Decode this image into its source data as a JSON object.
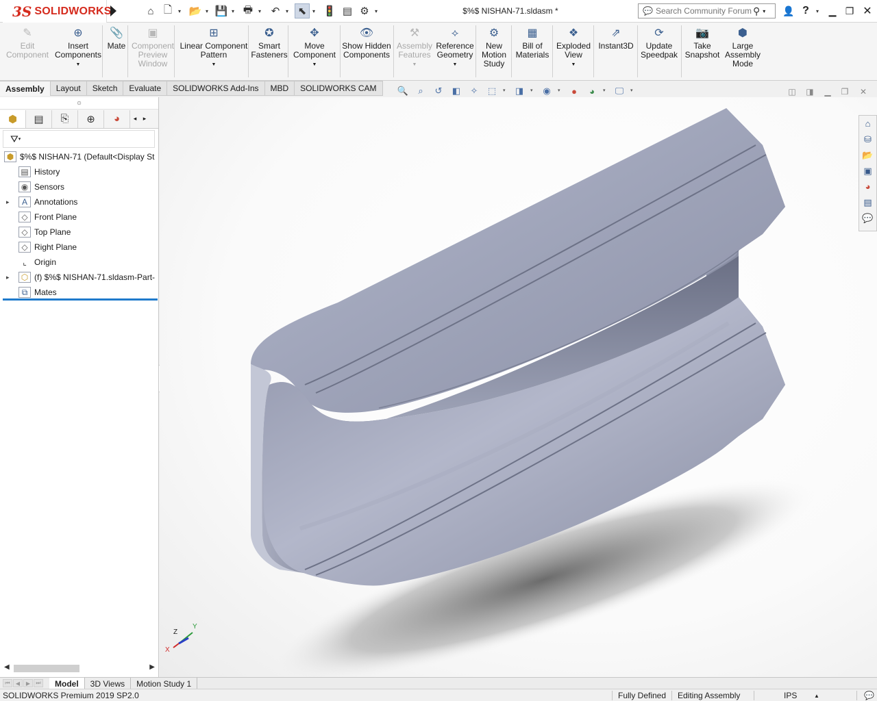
{
  "app": {
    "logo_ds": "3S",
    "logo_text": "SOLIDWORKS",
    "title": "$%$   NISHAN-71.sldasm *"
  },
  "search": {
    "placeholder": "Search Community Forum"
  },
  "quick_access": [
    {
      "name": "home-icon",
      "glyph": "⌂"
    },
    {
      "name": "new-document-icon",
      "glyph": "🗋"
    },
    {
      "name": "open-folder-icon",
      "glyph": "📂"
    },
    {
      "name": "save-icon",
      "glyph": "💾"
    },
    {
      "name": "print-icon",
      "glyph": "🖶"
    },
    {
      "name": "undo-icon",
      "glyph": "↶"
    },
    {
      "name": "select-arrow-icon",
      "glyph": "⬉"
    },
    {
      "name": "rebuild-traffic-light-icon",
      "glyph": "🚦"
    },
    {
      "name": "file-properties-icon",
      "glyph": "▤"
    },
    {
      "name": "options-gear-icon",
      "glyph": "⚙"
    }
  ],
  "command_manager": [
    {
      "key": "edit-component",
      "label": "Edit Component",
      "disabled": true,
      "glyph": "✎",
      "dropdown": false
    },
    {
      "key": "insert-components",
      "label": "Insert Components",
      "disabled": false,
      "glyph": "⊕",
      "dropdown": true
    },
    {
      "key": "mate",
      "label": "Mate",
      "disabled": false,
      "glyph": "📎",
      "dropdown": false
    },
    {
      "key": "component-preview-window",
      "label": "Component Preview Window",
      "disabled": true,
      "glyph": "▣",
      "dropdown": false
    },
    {
      "key": "linear-component-pattern",
      "label": "Linear Component Pattern",
      "disabled": false,
      "glyph": "⊞",
      "dropdown": true
    },
    {
      "key": "smart-fasteners",
      "label": "Smart Fasteners",
      "disabled": false,
      "glyph": "✪",
      "dropdown": false
    },
    {
      "key": "move-component",
      "label": "Move Component",
      "disabled": false,
      "glyph": "✥",
      "dropdown": true
    },
    {
      "key": "show-hidden-components",
      "label": "Show Hidden Components",
      "disabled": false,
      "glyph": "👁",
      "dropdown": false
    },
    {
      "key": "assembly-features",
      "label": "Assembly Features",
      "disabled": true,
      "glyph": "⚒",
      "dropdown": true
    },
    {
      "key": "reference-geometry",
      "label": "Reference Geometry",
      "disabled": false,
      "glyph": "⟡",
      "dropdown": true
    },
    {
      "key": "new-motion-study",
      "label": "New Motion Study",
      "disabled": false,
      "glyph": "⚙",
      "dropdown": false
    },
    {
      "key": "bill-of-materials",
      "label": "Bill of Materials",
      "disabled": false,
      "glyph": "▦",
      "dropdown": false
    },
    {
      "key": "exploded-view",
      "label": "Exploded View",
      "disabled": false,
      "glyph": "❖",
      "dropdown": true
    },
    {
      "key": "instant3d",
      "label": "Instant3D",
      "disabled": false,
      "glyph": "⇗",
      "dropdown": false
    },
    {
      "key": "update-speedpak",
      "label": "Update Speedpak",
      "disabled": false,
      "glyph": "⟳",
      "dropdown": false
    },
    {
      "key": "take-snapshot",
      "label": "Take Snapshot",
      "disabled": false,
      "glyph": "📷",
      "dropdown": false
    },
    {
      "key": "large-assembly-mode",
      "label": "Large Assembly Mode",
      "disabled": false,
      "glyph": "⬢",
      "dropdown": false
    }
  ],
  "tabs": [
    "Assembly",
    "Layout",
    "Sketch",
    "Evaluate",
    "SOLIDWORKS Add-Ins",
    "MBD",
    "SOLIDWORKS CAM"
  ],
  "active_tab": "Assembly",
  "feature_tree": [
    {
      "label": "$%$   NISHAN-71  (Default<Display St",
      "icon": "assembly-icon",
      "glyph": "⬢",
      "expandable": false,
      "indent": 0
    },
    {
      "label": "History",
      "icon": "history-icon",
      "glyph": "▤",
      "expandable": false,
      "indent": 1
    },
    {
      "label": "Sensors",
      "icon": "sensors-icon",
      "glyph": "◉",
      "expandable": false,
      "indent": 1
    },
    {
      "label": "Annotations",
      "icon": "annotations-icon",
      "glyph": "A",
      "expandable": true,
      "indent": 1
    },
    {
      "label": "Front Plane",
      "icon": "plane-icon",
      "glyph": "◇",
      "expandable": false,
      "indent": 1
    },
    {
      "label": "Top Plane",
      "icon": "plane-icon",
      "glyph": "◇",
      "expandable": false,
      "indent": 1
    },
    {
      "label": "Right Plane",
      "icon": "plane-icon",
      "glyph": "◇",
      "expandable": false,
      "indent": 1
    },
    {
      "label": "Origin",
      "icon": "origin-icon",
      "glyph": "⌞",
      "expandable": false,
      "indent": 1
    },
    {
      "label": "(f) $%$   NISHAN-71.sldasm-Part-",
      "icon": "part-icon",
      "glyph": "⬡",
      "expandable": true,
      "indent": 1
    },
    {
      "label": "Mates",
      "icon": "mates-icon",
      "glyph": "⧉",
      "expandable": false,
      "indent": 1
    }
  ],
  "bottom_tabs": [
    "Model",
    "3D Views",
    "Motion Study 1"
  ],
  "active_bottom_tab": "Model",
  "status": {
    "product": "SOLIDWORKS Premium 2019 SP2.0",
    "definition": "Fully Defined",
    "mode": "Editing Assembly",
    "units": "IPS"
  },
  "triad": {
    "x": "X",
    "y": "Y",
    "z": "Z"
  },
  "colors": {
    "model": "#9aa0b8",
    "accent_blue": "#1f7acb",
    "brand_red": "#d52b1e"
  }
}
